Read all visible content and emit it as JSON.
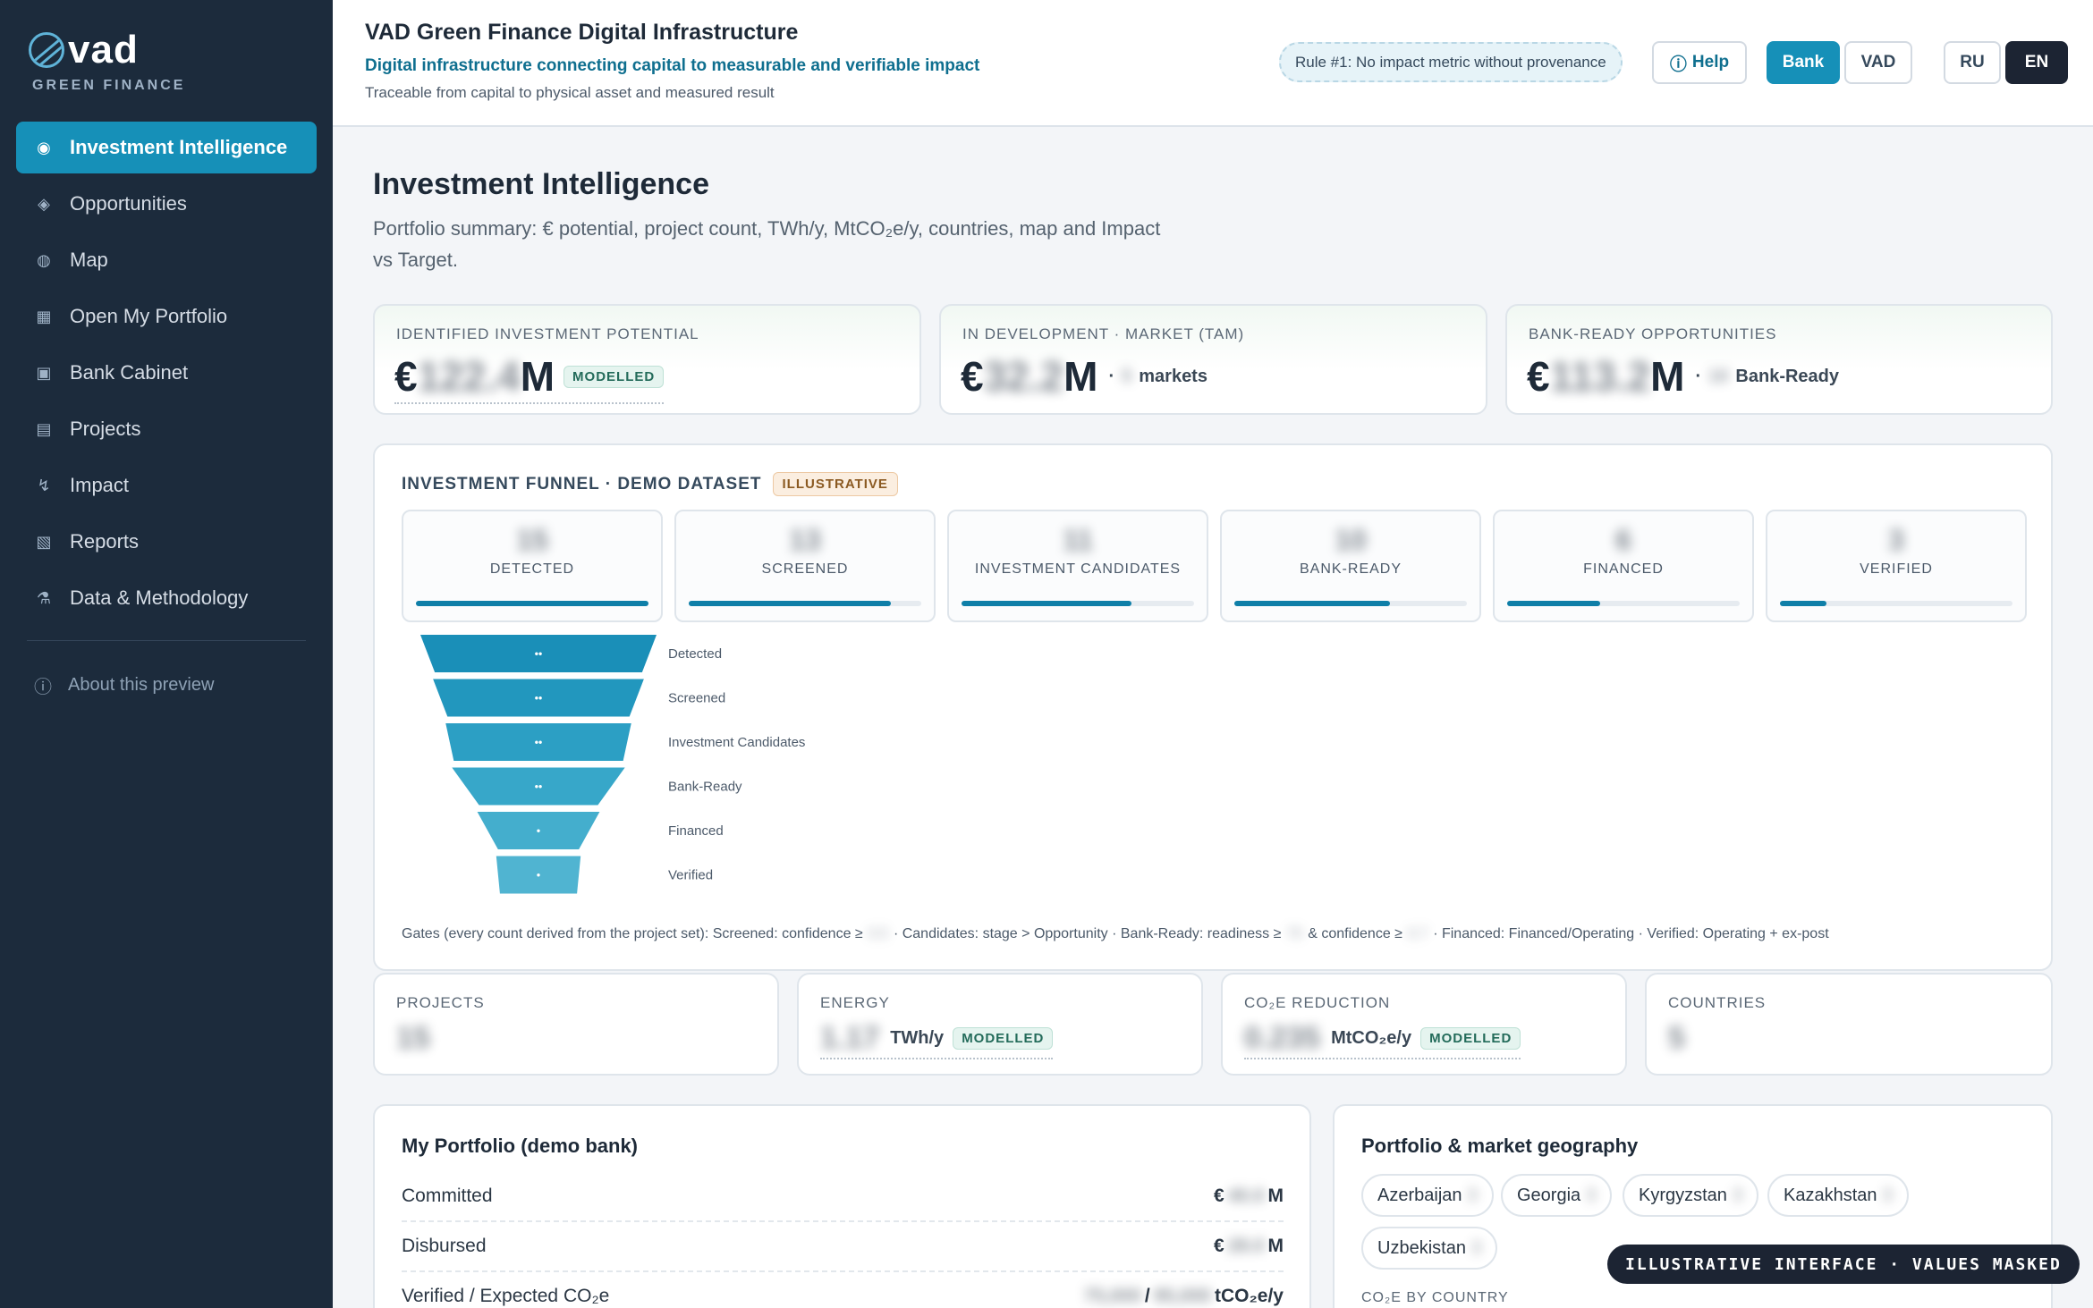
{
  "brand": {
    "name": "vad",
    "sub": "GREEN FINANCE"
  },
  "sidebar": {
    "items": [
      {
        "label": "Investment Intelligence",
        "icon": "target-icon",
        "glyph": "◉",
        "active": true
      },
      {
        "label": "Opportunities",
        "icon": "diamond-icon",
        "glyph": "◈"
      },
      {
        "label": "Map",
        "icon": "globe-icon",
        "glyph": "◍"
      },
      {
        "label": "Open My Portfolio",
        "icon": "grid-icon",
        "glyph": "▦"
      },
      {
        "label": "Bank Cabinet",
        "icon": "square-icon",
        "glyph": "▣"
      },
      {
        "label": "Projects",
        "icon": "list-icon",
        "glyph": "▤"
      },
      {
        "label": "Impact",
        "icon": "lightning-icon",
        "glyph": "↯"
      },
      {
        "label": "Reports",
        "icon": "report-icon",
        "glyph": "▧"
      },
      {
        "label": "Data & Methodology",
        "icon": "flask-icon",
        "glyph": "⚗"
      }
    ],
    "about": "About this preview"
  },
  "header": {
    "title": "VAD Green Finance Digital Infrastructure",
    "tagline": "Digital infrastructure connecting capital to measurable and verifiable impact",
    "subtitle": "Traceable from capital to physical asset and measured result",
    "rule": "Rule #1: No impact metric without provenance",
    "help": "Help",
    "roles": [
      "Bank",
      "VAD"
    ],
    "langs": [
      "RU",
      "EN"
    ],
    "active_role": "Bank",
    "active_lang": "EN"
  },
  "main": {
    "title": "Investment Intelligence",
    "description": "Portfolio summary: € potential, project count, TWh/y, MtCO₂e/y, countries, map and Impact vs Target."
  },
  "kpis": [
    {
      "label": "IDENTIFIED INVESTMENT POTENTIAL",
      "prefix": "€",
      "value": "122.4",
      "suffix": "M",
      "badge": "MODELLED",
      "extra": "",
      "extra_count": ""
    },
    {
      "label": "IN DEVELOPMENT · MARKET (TAM)",
      "prefix": "€",
      "value": "32.2",
      "suffix": "M",
      "badge": "",
      "extra": "markets",
      "extra_count": "5"
    },
    {
      "label": "BANK-READY OPPORTUNITIES",
      "prefix": "€",
      "value": "113.2",
      "suffix": "M",
      "badge": "",
      "extra": "Bank-Ready",
      "extra_count": "10"
    }
  ],
  "funnel": {
    "title": "INVESTMENT FUNNEL · DEMO DATASET",
    "badge": "ILLUSTRATIVE",
    "stages": [
      {
        "label": "DETECTED",
        "name": "Detected",
        "count": "15",
        "fill": 1.0
      },
      {
        "label": "SCREENED",
        "name": "Screened",
        "count": "13",
        "fill": 0.87
      },
      {
        "label": "INVESTMENT CANDIDATES",
        "name": "Investment Candidates",
        "count": "11",
        "fill": 0.73
      },
      {
        "label": "BANK-READY",
        "name": "Bank-Ready",
        "count": "10",
        "fill": 0.67
      },
      {
        "label": "FINANCED",
        "name": "Financed",
        "count": "6",
        "fill": 0.4
      },
      {
        "label": "VERIFIED",
        "name": "Verified",
        "count": "3",
        "fill": 0.2
      }
    ],
    "segment_marks": [
      "••",
      "••",
      "••",
      "••",
      "•",
      "•"
    ],
    "gates": {
      "prefix": "Gates (every count derived from the project set): Screened: confidence ≥",
      "confidence": "0.5",
      "mid": "· Candidates: stage > Opportunity · Bank-Ready: readiness ≥",
      "readiness": "70",
      "and": "& confidence ≥",
      "confidence2": "0.7",
      "suffix": "· Financed: Financed/Operating · Verified: Operating + ex-post"
    },
    "colors": [
      "#1a8fb8",
      "#2297be",
      "#2c9fc4",
      "#37a7c9",
      "#44aecd",
      "#50b4d1"
    ]
  },
  "stats": [
    {
      "label": "PROJECTS",
      "value": "15",
      "unit": "",
      "badge": ""
    },
    {
      "label": "ENERGY",
      "value": "1.17",
      "unit": "TWh/y",
      "badge": "MODELLED"
    },
    {
      "label": "CO₂E REDUCTION",
      "value": "0.235",
      "unit": "MtCO₂e/y",
      "badge": "MODELLED"
    },
    {
      "label": "COUNTRIES",
      "value": "5",
      "unit": "",
      "badge": ""
    }
  ],
  "portfolio": {
    "title": "My Portfolio (demo bank)",
    "rows": [
      {
        "label": "Committed",
        "prefix": "€",
        "value": "40.0",
        "suffix": "M"
      },
      {
        "label": "Disbursed",
        "prefix": "€",
        "value": "28.0",
        "suffix": "M"
      },
      {
        "label": "Verified / Expected CO₂e",
        "prefix": "",
        "value": "75,000",
        "sep": "/",
        "value2": "95,000",
        "suffix": "tCO₂e/y"
      }
    ]
  },
  "geography": {
    "title": "Portfolio & market geography",
    "countries": [
      {
        "name": "Azerbaijan",
        "count": "3"
      },
      {
        "name": "Georgia",
        "count": "3"
      },
      {
        "name": "Kyrgyzstan",
        "count": "3"
      },
      {
        "name": "Kazakhstan",
        "count": "3"
      },
      {
        "name": "Uzbekistan",
        "count": "3"
      }
    ],
    "sub": "CO₂E BY COUNTRY"
  },
  "toast": "ILLUSTRATIVE INTERFACE · VALUES MASKED"
}
